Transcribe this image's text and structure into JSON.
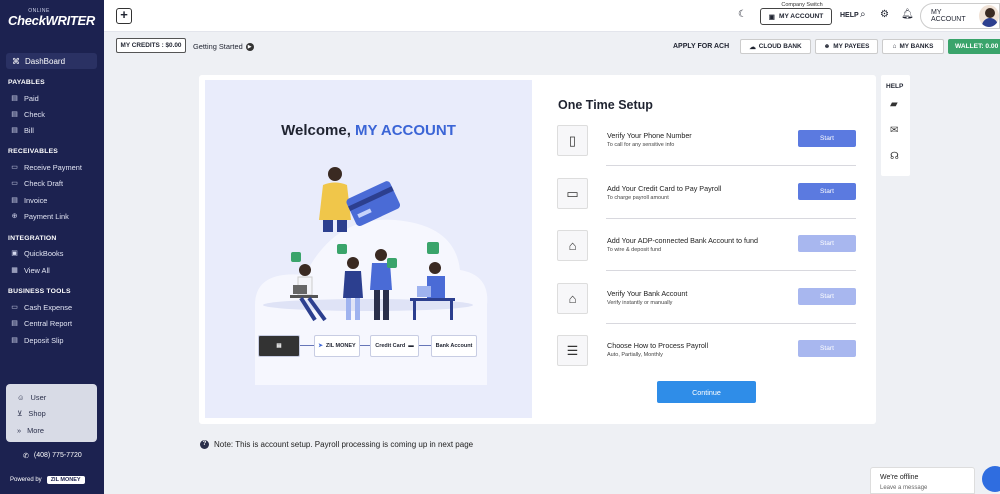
{
  "sidebar": {
    "logo_small": "ONLINE",
    "logo_big": "CheckWRITER",
    "dashboard": "DashBoard",
    "sections": {
      "payables": "PAYABLES",
      "receivables": "RECEIVABLES",
      "integration": "INTEGRATION",
      "business_tools": "BUSINESS TOOLS"
    },
    "payables": [
      "Paid",
      "Check",
      "Bill"
    ],
    "receivables": [
      "Receive Payment",
      "Check Draft",
      "Invoice",
      "Payment Link"
    ],
    "integration": [
      "QuickBooks",
      "View All"
    ],
    "business_tools": [
      "Cash Expense",
      "Central Report",
      "Deposit Slip"
    ],
    "bottom": [
      "User",
      "Shop",
      "More"
    ],
    "phone": "(408) 775-7720",
    "powered_by": "Powered by",
    "powered_brand": "ZIL MONEY"
  },
  "topbar": {
    "company_switch_label": "Company Switch",
    "company_switch_value": "MY ACCOUNT",
    "help": "HELP",
    "account": "MY ACCOUNT"
  },
  "subbar": {
    "credits": "MY CREDITS : $0.00",
    "getting_started": "Getting Started",
    "apply_ach": "APPLY FOR ACH",
    "cloud_bank": "CLOUD BANK",
    "my_payees": "MY PAYEES",
    "my_banks": "MY BANKS",
    "wallet": "WALLET: 0.00"
  },
  "welcome": {
    "prefix": "Welcome,",
    "account": "MY ACCOUNT"
  },
  "flow": {
    "zil": "ZIL MONEY",
    "credit_card": "Credit Card",
    "bank_account": "Bank Account"
  },
  "setup": {
    "title": "One Time Setup",
    "steps": [
      {
        "title": "Verify Your Phone Number",
        "subtitle": "To call for any sensitive info",
        "button": "Start"
      },
      {
        "title": "Add Your Credit Card to Pay Payroll",
        "subtitle": "To charge payroll amount",
        "button": "Start"
      },
      {
        "title": "Add Your ADP-connected Bank Account to fund",
        "subtitle": "To wire & deposit fund",
        "button": "Start"
      },
      {
        "title": "Verify Your Bank Account",
        "subtitle": "Verify instantly or manually",
        "button": "Start"
      },
      {
        "title": "Choose How to Process Payroll",
        "subtitle": "Auto, Partially, Monthly",
        "button": "Start"
      }
    ],
    "continue": "Continue"
  },
  "help_panel": {
    "label": "HELP"
  },
  "note": "Note: This is account setup. Payroll processing is coming up in next page",
  "chat": {
    "status": "We're offline",
    "action": "Leave a message"
  },
  "colors": {
    "sidebar": "#1c2250",
    "primary": "#5b7ae0",
    "wallet": "#3aa46b",
    "continue": "#2f8de8",
    "accent_text": "#3b65d6"
  }
}
